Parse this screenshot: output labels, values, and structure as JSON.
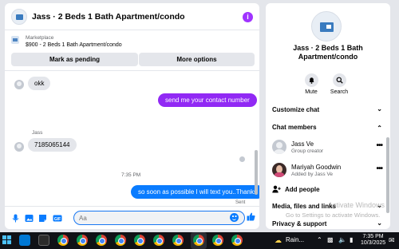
{
  "chat": {
    "title": "Jass · 2 Beds 1 Bath Apartment/condo",
    "marketplace_label": "Marketplace",
    "listing": "$900 - 2 Beds 1 Bath Apartment/condo",
    "buttons": {
      "pending": "Mark as pending",
      "options": "More options"
    },
    "messages": {
      "okk": "okk",
      "contact": "send me your contact number",
      "sender_name": "Jass",
      "phone": "7185065144",
      "time": "7:35 PM",
      "reply": "so soon as possible I will text you..Thanks",
      "sent": "Sent"
    },
    "composer_placeholder": "Aa"
  },
  "info": {
    "title": "Jass · 2 Beds 1 Bath Apartment/condo",
    "actions": {
      "mute": "Mute",
      "search": "Search"
    },
    "sections": {
      "customize": "Customize chat",
      "members": "Chat members",
      "media": "Media, files and links",
      "privacy": "Privacy & support"
    },
    "members": [
      {
        "name": "Jass Ve",
        "role": "Group creator"
      },
      {
        "name": "Mariyah Goodwin",
        "role": "Added by Jass Ve"
      }
    ],
    "add_people": "Add people"
  },
  "watermark": {
    "line1": "Activate Windows",
    "line2": "Go to Settings to activate Windows."
  },
  "taskbar": {
    "weather": "Rain...",
    "time": "7:35 PM",
    "date": "10/3/2025"
  },
  "colors": {
    "outgoing": "#9129f4",
    "outgoing_blue": "#0a7cff",
    "accent": "#a033ff"
  }
}
